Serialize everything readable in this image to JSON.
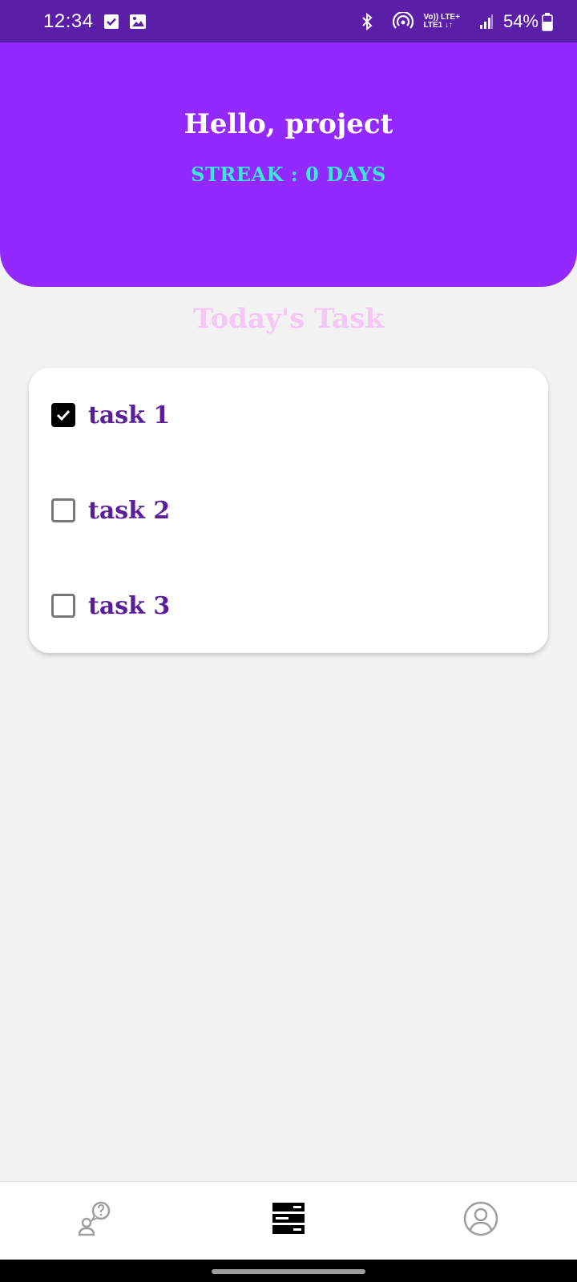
{
  "status_bar": {
    "time": "12:34",
    "network_top": "Vo)) LTE+",
    "network_bottom": "LTE1 ↓↑",
    "battery": "54%",
    "icons": [
      "checkbox-notification-icon",
      "image-notification-icon",
      "bluetooth-icon",
      "hotspot-icon",
      "signal-icon",
      "battery-icon"
    ]
  },
  "header": {
    "greeting": "Hello, project",
    "streak": "STREAK : 0 DAYS"
  },
  "tasks": {
    "title": "Today's Task",
    "items": [
      {
        "label": "task 1",
        "checked": true
      },
      {
        "label": "task 2",
        "checked": false
      },
      {
        "label": "task 3",
        "checked": false
      }
    ]
  },
  "bottom_nav": {
    "items": [
      {
        "icon": "help-person-icon",
        "active": false
      },
      {
        "icon": "task-list-icon",
        "active": true
      },
      {
        "icon": "account-circle-icon",
        "active": false
      }
    ]
  },
  "colors": {
    "status_bar": "#5b1ea6",
    "header": "#9429ff",
    "streak": "#3ee6d8",
    "section_title": "#f6c6f6",
    "task_text": "#5a1e9c"
  }
}
